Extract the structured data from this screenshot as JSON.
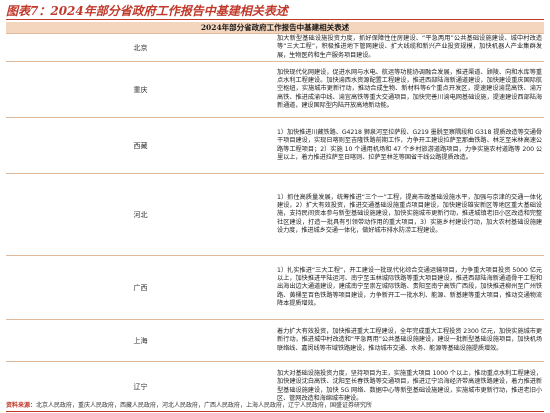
{
  "figure_title": "图表7：2024年部分省政府工作报告中基建相关表述",
  "table": {
    "header": "2024年部分省政府工作报告中基建相关表述",
    "rows": [
      {
        "province": "北京",
        "text": "加大新型基础设施投资力度，抓好保障性住房建设、“平急两用”公共基础设施建设、城中村改造等“三大工程”，积极推进地下管网建设、扩大线缆和新兴产业投资规模，加快机器人产业集群发展，生物医药和生产服务项目建设。"
      },
      {
        "province": "重庆",
        "text": "加快现代化网建设，促进水网与水电、航运等功能协调融合发展，推进渠道、顾陵、向和水库等重点水利工程建设。加快渝西水资源配置工程建设，推进西部陆海新通道建设，加快建设重庆国际航空枢纽，实施城市更新行动，推动合成生物、新材料等6个重点开发区，提速建设渝昆高铁、渝万高铁、推进成渝中线、渝宜高铁等重大交通项目，加快完善川渝电网基础设施，提速建设西部陆海新通道，建设国际型内陆开放高地新动能。"
      },
      {
        "province": "西藏",
        "text": "1）加快推进川藏铁路、G4218 狮泉河至拉萨段、G219 墨脱至察隅段和 G318 提质改造等交通骨干项目建设，实现日喀则至吉隆铁路前期工作，力争开工建设拉萨至那曲铁路、林芝至米林高速公路等工程项目；2）实施 10 个通用机场和 47 个乡村旅游道路项目，力争实施农村道路等 200 公里以上，着力推进拉萨至日喀则、拉萨至林芝等国省干线公路提质改造。"
      },
      {
        "province": "河北",
        "text": "1）抓住高质量发展，统筹推进“三个一”工程，提高市政基础设施水平，加强与京津的交通一体化建设，2）扩大有效投资，推进交通基础设施重点项目建设，加快建设雄安新区等地区重大基础设施，支持民间资本参与新型基础设施建设，加快实施城市更新行动，推进城镇老旧小区改造和完整社区建设，打造一批具有引领带动作用的重大项目，3）实施乡村建设行动，加大农村基础设施建设力度，推进城乡交通一体化，做好城市排水防涝工程建设。"
      },
      {
        "province": "广西",
        "text": "1）扎实推进“三大工程”，开工建设一批现代化综合交通运输项目，力争重大项目投资 5000 亿元以上，加快推进平陆运河、南宁至玉林城际铁路等重大项目建设，推进西部陆海新通道骨干工程和出海出边大通道建设，建成南宁至崇左城际铁路、贵阳至南宁高铁广西段，加快推进柳州至广州铁路、黄桶至百色铁路等项目建设，力争新开工一批水利、能源、新基建等重大项目，推动交通物流降本提质增效。"
      },
      {
        "province": "上海",
        "text": "着力扩大有效投资，加快推进重大工程建设，全年完成重大工程投资 2300 亿元，加快实施城市更新行动，推进城中村改造和“平急两用”公共基础设施建设，建设一批新型基础设施项目，加快机场联络线、嘉闵线等市域铁路建设，推动城市交通、水务、能源等基础设施提质增效。"
      },
      {
        "province": "辽宁",
        "text": "加大对基础设施投资力度，坚持项目为王，实施重大项目 1000 个以上，推动重点水利工程建设，加快建设沈白高铁、沈阳至长春铁路等交通项目，推进辽宁沿海经济带高速铁路建设，着力推进新型基础设施建设，加快 5G 网络、数据中心等新型基础设施建设，实施城市更新行动，推进老旧小区、管网改造和海绵城市建设。"
      }
    ]
  },
  "source": {
    "label": "资料来源：",
    "text": "北京人民政府，重庆人民政府，西藏人民政府，河北人民政府，广西人民政府，上海人民政府，辽宁人民政府，国盛证券研究所"
  }
}
